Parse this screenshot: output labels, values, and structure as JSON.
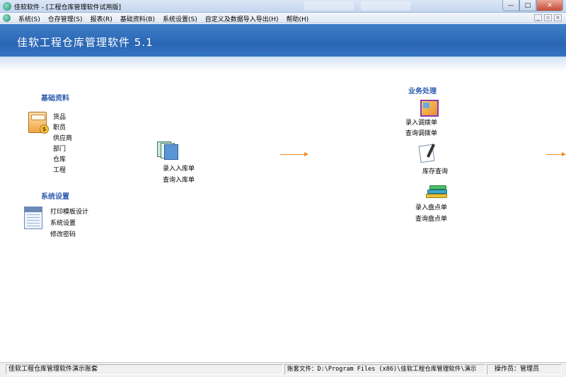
{
  "window": {
    "title": "佳软软件 - [工程仓库管理软件试用版]",
    "controls": {
      "minimize": "—",
      "maximize": "□",
      "close": "✕"
    }
  },
  "menu": {
    "items": [
      "系统(S)",
      "仓存管理(S)",
      "报表(R)",
      "基础资料(B)",
      "系统设置(S)",
      "自定义及数据导入导出(H)",
      "帮助(H)"
    ],
    "mdi_controls": {
      "minimize": "_",
      "restore": "▫",
      "close": "×"
    }
  },
  "banner": {
    "app_name": "佳软工程仓库管理软件 5.1"
  },
  "basic_data": {
    "title": "基础资料",
    "icon": "calculator-coin-icon",
    "links": [
      "货品",
      "职员",
      "供应商",
      "部门",
      "仓库",
      "工程"
    ]
  },
  "system_settings": {
    "title": "系统设置",
    "icon": "form-sheet-icon",
    "links": [
      "打印模板设计",
      "系统设置",
      "修改密码"
    ]
  },
  "inbound": {
    "icon": "stacked-sheets-icon",
    "links": [
      "录入入库单",
      "查询入库单"
    ]
  },
  "business": {
    "title": "业务处理",
    "transfer": {
      "icon": "window-transfer-icon",
      "links": [
        "录入调拨单",
        "查询调拨单"
      ]
    },
    "stock_query": {
      "icon": "document-pen-icon",
      "label": "库存查询"
    },
    "stocktake": {
      "icon": "books-stack-icon",
      "links": [
        "录入盘点单",
        "查询盘点单"
      ]
    }
  },
  "status": {
    "account": "佳软工程仓库管理软件演示账套",
    "file": "账套文件：D:\\Program Files (x86)\\佳软工程仓库管理软件\\演示",
    "operator": "操作员：管理员"
  },
  "colors": {
    "banner": "#2a66b4",
    "section_title": "#2b5bb0",
    "arrow": "#f08a24"
  }
}
